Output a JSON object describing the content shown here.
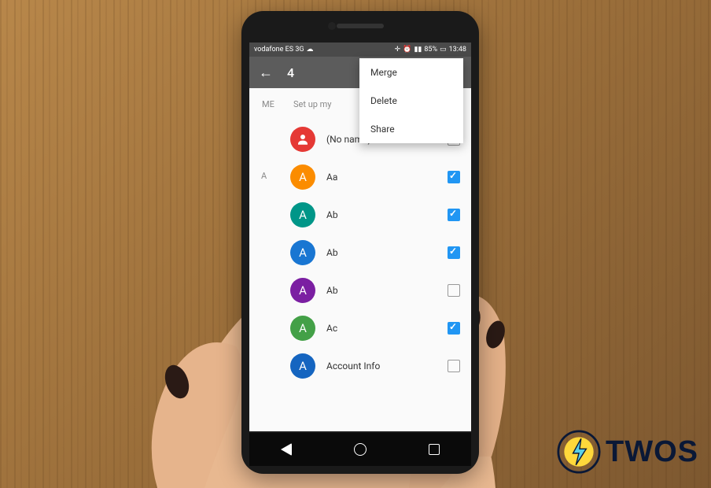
{
  "status_bar": {
    "carrier": "vodafone ES 3G",
    "battery_pct": "85%",
    "time": "13:48"
  },
  "toolbar": {
    "selected_count": "4"
  },
  "popup_menu": {
    "items": [
      {
        "label": "Merge"
      },
      {
        "label": "Delete"
      },
      {
        "label": "Share"
      }
    ]
  },
  "me_section": {
    "label": "ME",
    "setup_text": "Set up my"
  },
  "sections": [
    {
      "letter": "A"
    }
  ],
  "contacts": [
    {
      "name": "(No name)",
      "avatar_letter": "",
      "avatar_color": "#e53935",
      "avatar_icon": "person",
      "checked": false
    },
    {
      "name": "Aa",
      "avatar_letter": "A",
      "avatar_color": "#fb8c00",
      "checked": true,
      "section_letter": "A"
    },
    {
      "name": "Ab",
      "avatar_letter": "A",
      "avatar_color": "#009688",
      "checked": true
    },
    {
      "name": "Ab",
      "avatar_letter": "A",
      "avatar_color": "#1976d2",
      "checked": true
    },
    {
      "name": "Ab",
      "avatar_letter": "A",
      "avatar_color": "#7b1fa2",
      "checked": false
    },
    {
      "name": "Ac",
      "avatar_letter": "A",
      "avatar_color": "#43a047",
      "checked": true
    },
    {
      "name": "Account Info",
      "avatar_letter": "A",
      "avatar_color": "#1565c0",
      "checked": false
    }
  ],
  "colors": {
    "checkbox_checked": "#2196f3",
    "toolbar_bg": "#5c5c5c"
  },
  "watermark": {
    "text": "TWOS"
  }
}
